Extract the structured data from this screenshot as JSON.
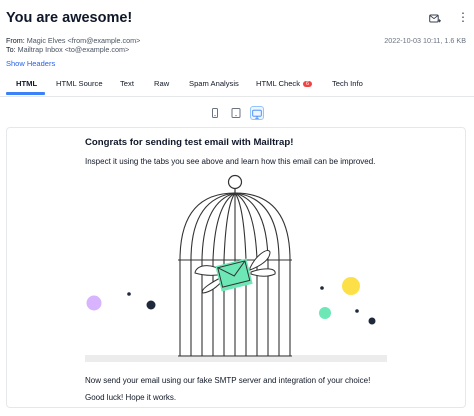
{
  "email": {
    "subject": "You are awesome!",
    "from_label": "From:",
    "from_value": "Magic Elves <from@example.com>",
    "to_label": "To:",
    "to_value": "Mailtrap Inbox <to@example.com>",
    "date_size": "2022-10-03 10:11, 1.6 KB",
    "show_headers": "Show Headers"
  },
  "header_icons": [
    "forward-icon",
    "more-icon"
  ],
  "tabs": [
    {
      "label": "HTML",
      "active": true
    },
    {
      "label": "HTML Source"
    },
    {
      "label": "Text"
    },
    {
      "label": "Raw"
    },
    {
      "label": "Spam Analysis"
    },
    {
      "label": "HTML Check",
      "badge": "6"
    },
    {
      "label": "Tech Info"
    }
  ],
  "device_icons": [
    "mobile-icon",
    "tablet-icon",
    "desktop-icon"
  ],
  "body": {
    "title": "Congrats for sending test email with Mailtrap!",
    "intro": "Inspect it using the tabs you see above and learn how this email can be improved.",
    "outro": "Now send your email using our fake SMTP server and integration of your choice!",
    "signoff": "Good luck! Hope it works."
  },
  "colors": {
    "accent": "#3b82f6",
    "link": "#2563eb",
    "badge": "#ef4444",
    "envelope": "#6ee7b7",
    "dot_purple": "#d8b4fe",
    "dot_yellow": "#fde047",
    "dot_teal": "#6ee7b7",
    "dot_navy": "#1e293b"
  }
}
